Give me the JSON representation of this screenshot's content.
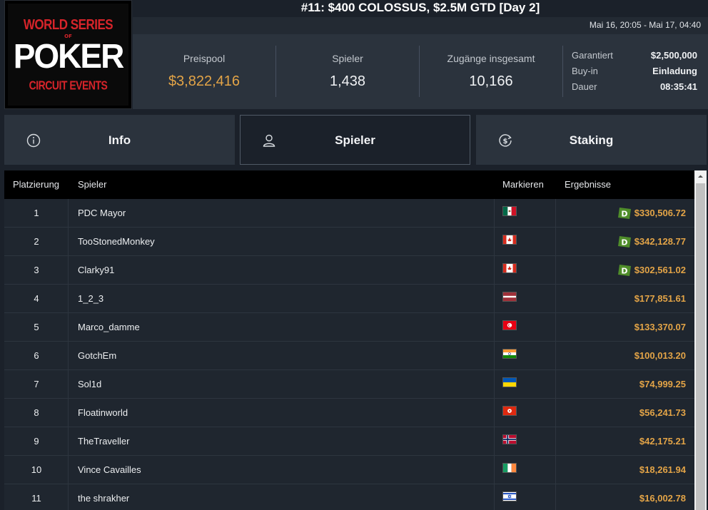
{
  "logo": {
    "line1": "WORLD SERIES",
    "line2": "OF",
    "line3": "POKER",
    "line4": "CIRCUIT EVENTS"
  },
  "header": {
    "title": "#11: $400 COLOSSUS, $2.5M GTD [Day 2]",
    "date_range": "Mai 16, 20:05 - Mai 17, 04:40"
  },
  "stats": {
    "prize_pool": {
      "label": "Preispool",
      "value": "$3,822,416"
    },
    "players": {
      "label": "Spieler",
      "value": "1,438"
    },
    "entries": {
      "label": "Zugänge insgesamt",
      "value": "10,166"
    },
    "details": [
      {
        "key": "Garantiert",
        "value": "$2,500,000"
      },
      {
        "key": "Buy-in",
        "value": "Einladung"
      },
      {
        "key": "Dauer",
        "value": "08:35:41"
      }
    ]
  },
  "tabs": [
    {
      "label": "Info",
      "icon": "info-icon"
    },
    {
      "label": "Spieler",
      "icon": "user-icon"
    },
    {
      "label": "Staking",
      "icon": "staking-dollar-icon"
    }
  ],
  "table": {
    "headers": {
      "rank": "Platzierung",
      "player": "Spieler",
      "flag": "Markieren",
      "result": "Ergebnisse"
    },
    "rows": [
      {
        "rank": "1",
        "player": "PDC Mayor",
        "flag": "mx",
        "result": "$330,506.72",
        "badge": "D"
      },
      {
        "rank": "2",
        "player": "TooStonedMonkey",
        "flag": "ca",
        "result": "$342,128.77",
        "badge": "D"
      },
      {
        "rank": "3",
        "player": "Clarky91",
        "flag": "ca",
        "result": "$302,561.02",
        "badge": "D"
      },
      {
        "rank": "4",
        "player": "1_2_3",
        "flag": "lv",
        "result": "$177,851.61",
        "badge": ""
      },
      {
        "rank": "5",
        "player": "Marco_damme",
        "flag": "tn",
        "result": "$133,370.07",
        "badge": ""
      },
      {
        "rank": "6",
        "player": "GotchEm",
        "flag": "in",
        "result": "$100,013.20",
        "badge": ""
      },
      {
        "rank": "7",
        "player": "Sol1d",
        "flag": "ua",
        "result": "$74,999.25",
        "badge": ""
      },
      {
        "rank": "8",
        "player": "Floatinworld",
        "flag": "hk",
        "result": "$56,241.73",
        "badge": ""
      },
      {
        "rank": "9",
        "player": "TheTraveller",
        "flag": "no",
        "result": "$42,175.21",
        "badge": ""
      },
      {
        "rank": "10",
        "player": "Vince Cavailles",
        "flag": "ie",
        "result": "$18,261.94",
        "badge": ""
      },
      {
        "rank": "11",
        "player": "the shrakher",
        "flag": "il",
        "result": "$16,002.78",
        "badge": ""
      }
    ]
  },
  "colors": {
    "gold": "#e3a447",
    "badge_green": "#4f8d2a",
    "panel": "#2b333d",
    "background": "#1b212a"
  }
}
